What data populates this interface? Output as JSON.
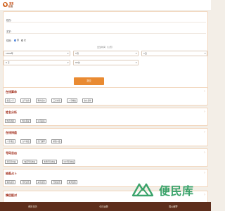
{
  "header": {
    "logo_top": "宝宝",
    "logo_bottom_1": "起",
    "logo_bottom_2": "名"
  },
  "form": {
    "surname_label": "姓氏:",
    "name_label": "名字:",
    "gender_label": "性别:",
    "gender_options": [
      "男",
      "女"
    ],
    "date_label": "出生时间（公历）",
    "year": "1990年",
    "month": "1月",
    "day": "1日",
    "hour": "0 子",
    "minute": "00分",
    "submit": "提交"
  },
  "sections": [
    {
      "title": "在线算命",
      "tags": [
        "生辰八字",
        "日干论命",
        "称骨论命",
        "三世书签",
        "八字精批",
        "金木流年"
      ]
    },
    {
      "title": "姓名分析",
      "tags": [
        "姓名测试",
        "姓名匹配",
        "公司起名"
      ]
    },
    {
      "title": "在线排盘",
      "tags": [
        "八字排盘",
        "六爻排盘",
        "奇门遁甲",
        "紫微斗数"
      ]
    },
    {
      "title": "号码吉凶",
      "tags": [
        "手机号吉凶",
        "电话号码吉凶",
        "车牌号码吉凶",
        "QQ号码吉凶"
      ]
    },
    {
      "title": "抽签占卜",
      "tags": [
        "观音灵签",
        "月老灵签",
        "关帝灵签",
        "吕祖灵签",
        "黄大仙签"
      ]
    },
    {
      "title": "情侣配对",
      "tags": []
    }
  ],
  "watermark": {
    "text": "便民库"
  },
  "footer": {
    "links": [
      "黄历日历",
      "今日运势",
      "周公解梦"
    ]
  },
  "colors": {
    "accent": "#e98a31",
    "title": "#a12d1a",
    "footer": "#5e2e1c",
    "watermark": "#3aa36b"
  }
}
